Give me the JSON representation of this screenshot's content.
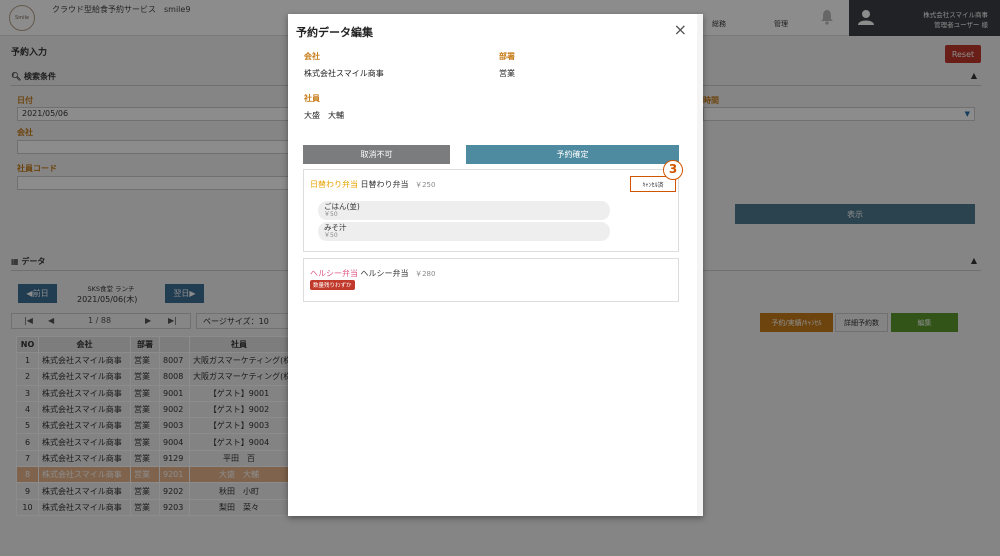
{
  "header": {
    "logo_text": "Smile",
    "app_title": "クラウド型給食予約サービス　smile9",
    "nav": [
      "総務",
      "管理"
    ],
    "user_company": "株式会社スマイル商事",
    "user_name": "管理者ユーザー 様"
  },
  "page": {
    "title": "予約入力",
    "reset_label": "Reset",
    "search_section": "検索条件",
    "date_label": "日付",
    "date_value": "2021/05/06",
    "company_label": "会社",
    "company_value": "",
    "employee_code_label": "社員コード",
    "employee_code_value": "",
    "time_label": "時間",
    "show_label": "表示",
    "data_section": "データ",
    "prev_day": "◀前日",
    "next_day": "翌日▶",
    "cafeteria": "SKS食堂 ランチ",
    "current_date": "2021/05/06(木)",
    "pager_text": "1 / 88",
    "page_size_label": "ページサイズ：10",
    "btn_reserve": "予約/実績/ｷｬﾝｾﾙ",
    "btn_detail": "詳細予約数",
    "btn_edit": "編集"
  },
  "table": {
    "headers": [
      "NO",
      "会社",
      "部署",
      "",
      "社員"
    ],
    "rows": [
      [
        "1",
        "株式会社スマイル商事",
        "営業",
        "8007",
        "大阪ガスマーケティング(株"
      ],
      [
        "2",
        "株式会社スマイル商事",
        "営業",
        "8008",
        "大阪ガスマーケティング(株"
      ],
      [
        "3",
        "株式会社スマイル商事",
        "営業",
        "9001",
        "【ゲスト】9001"
      ],
      [
        "4",
        "株式会社スマイル商事",
        "営業",
        "9002",
        "【ゲスト】9002"
      ],
      [
        "5",
        "株式会社スマイル商事",
        "営業",
        "9003",
        "【ゲスト】9003"
      ],
      [
        "6",
        "株式会社スマイル商事",
        "営業",
        "9004",
        "【ゲスト】9004"
      ],
      [
        "7",
        "株式会社スマイル商事",
        "営業",
        "9129",
        "平田　百"
      ],
      [
        "8",
        "株式会社スマイル商事",
        "営業",
        "9201",
        "大盛　大輔"
      ],
      [
        "9",
        "株式会社スマイル商事",
        "営業",
        "9202",
        "秋田　小町"
      ],
      [
        "10",
        "株式会社スマイル商事",
        "営業",
        "9203",
        "梨田　菜々"
      ]
    ]
  },
  "modal": {
    "title": "予約データ編集",
    "close": "×",
    "company_label": "会社",
    "company_value": "株式会社スマイル商事",
    "dept_label": "部署",
    "dept_value": "営業",
    "employee_label": "社員",
    "employee_value": "大盛　大輔",
    "btn_no_cancel": "取消不可",
    "btn_confirm": "予約確定",
    "menu1": {
      "category": "日替わり弁当",
      "name": "日替わり弁当",
      "price": "￥250",
      "status_button": "ｷｬﾝｾﾙ済",
      "options": [
        {
          "name": "ごはん(並)",
          "price": "￥50"
        },
        {
          "name": "みそ汁",
          "price": "￥50"
        }
      ]
    },
    "menu2": {
      "category": "ヘルシー弁当",
      "name": "ヘルシー弁当",
      "price": "￥280",
      "badge": "数量残りわずか"
    },
    "step_number": "3"
  },
  "colors": {
    "accent_orange": "#c77d1a",
    "highlight": "#d35400",
    "confirm_button": "#4e8ba0",
    "disabled_button": "#7a7c7d"
  }
}
